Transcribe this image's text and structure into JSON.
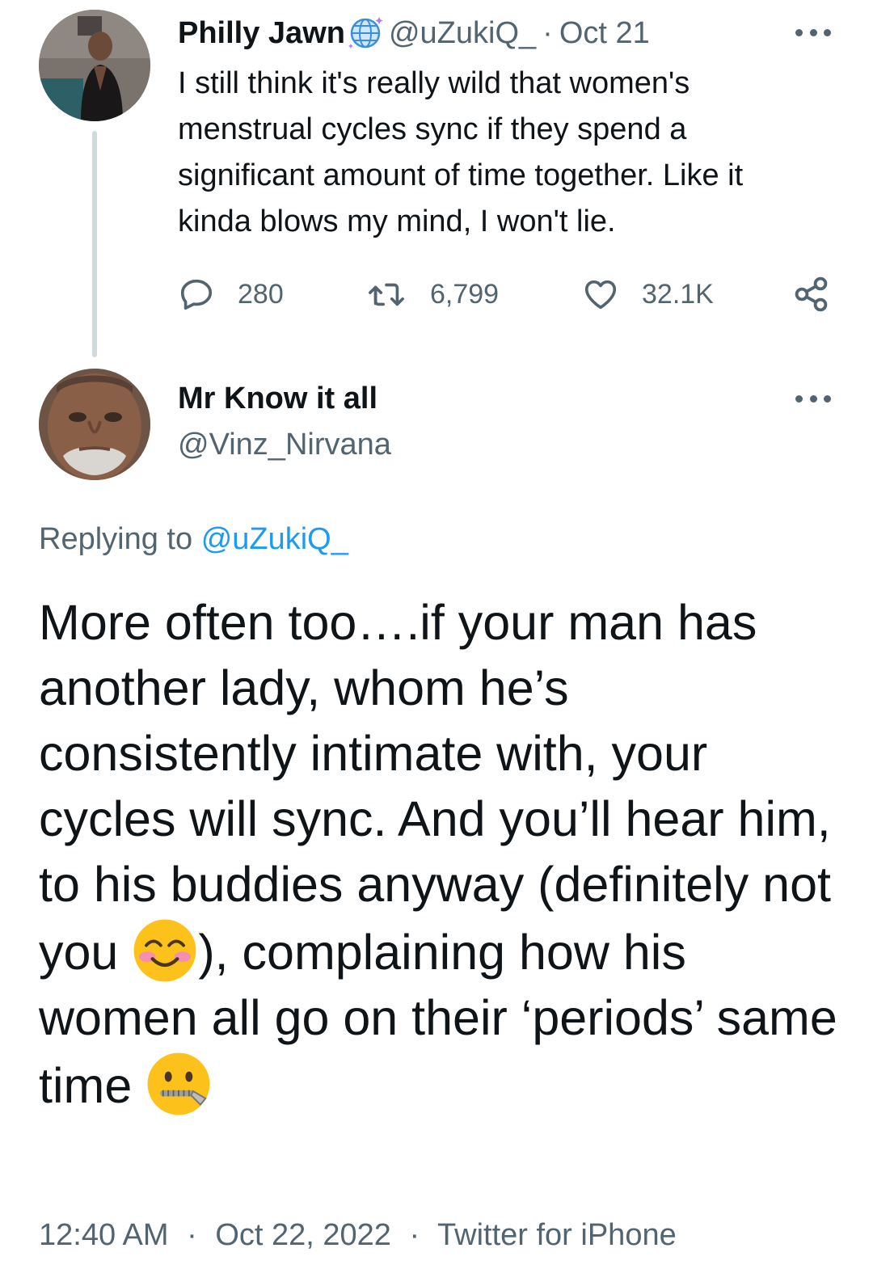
{
  "parent_tweet": {
    "display_name": "Philly Jawn",
    "handle": "@uZukiQ_",
    "separator": "·",
    "date": "Oct 21",
    "text": "I still think it's really wild that women's\nmenstrual cycles sync if they spend a\nsignificant amount of time together. Like it\nkinda blows my mind, I won't lie.",
    "replies": "280",
    "retweets": "6,799",
    "likes": "32.1K"
  },
  "reply_tweet": {
    "display_name": "Mr Know it all",
    "handle": "@Vinz_Nirvana",
    "replying_prefix": "Replying to",
    "replying_mention": "@uZukiQ_",
    "text_part1": "More often too….if your man has another lady, whom he’s consistently intimate with, your cycles will sync. And you’ll hear him, to his buddies anyway (definitely not you ",
    "text_part2": "), complaining how his women all go on their ‘periods’ same time ",
    "emoji_1": "smiling-face-with-smiling-eyes",
    "emoji_2": "zipper-mouth-face"
  },
  "meta": {
    "time": "12:40 AM",
    "separator": "·",
    "date": "Oct 22, 2022",
    "source": "Twitter for iPhone"
  },
  "colors": {
    "text_primary": "#0f1419",
    "text_secondary": "#536471",
    "link": "#1d9bf0",
    "thread_line": "#cfd9de"
  }
}
